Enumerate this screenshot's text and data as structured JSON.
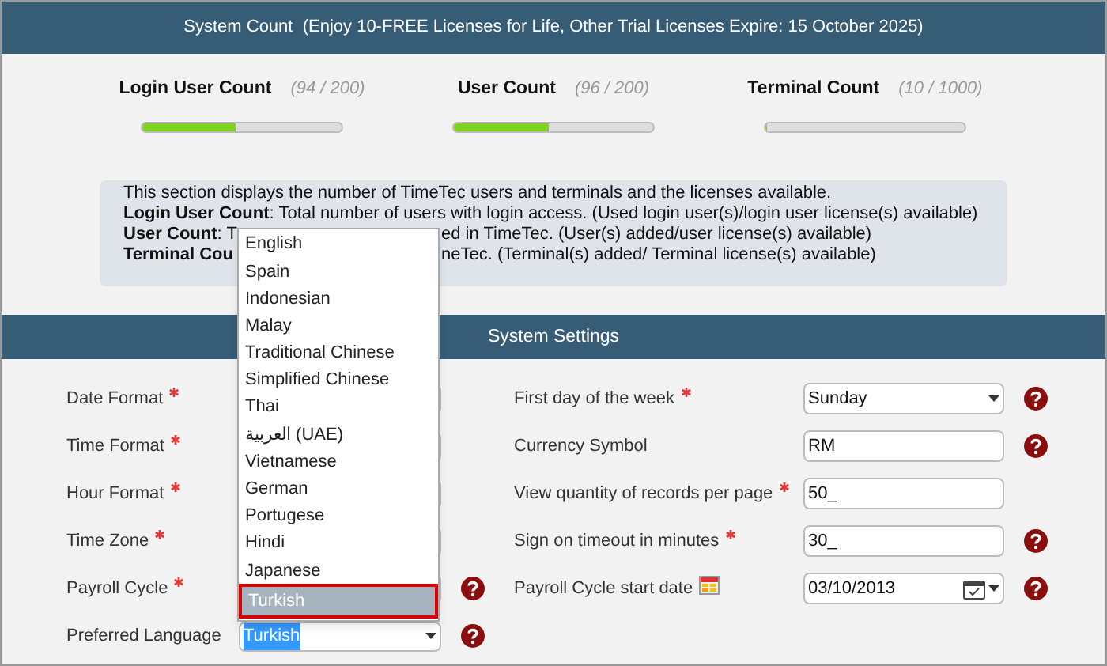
{
  "header": {
    "title": "System Count  (Enjoy 10-FREE Licenses for Life, Other Trial Licenses Expire: 15 October 2025)"
  },
  "counts": [
    {
      "label": "Login User Count",
      "reading": "(94 / 200)",
      "level": 0.47
    },
    {
      "label": "User Count",
      "reading": "(96 / 200)",
      "level": 0.48
    },
    {
      "label": "Terminal Count",
      "reading": "(10 / 1000)",
      "level": 0.01
    }
  ],
  "info": {
    "lines": [
      {
        "left": "This section displays the number of TimeTec users and terminals and the licenses available."
      },
      {
        "left": "**Login User Count**: Total number of users with login access. (Used login user(s)/login user license(s) available)"
      },
      {
        "left": "**User Count**: T",
        "right": "ed in TimeTec. (User(s) added/user license(s) available)"
      },
      {
        "left": "**Terminal Cou**",
        "right": "neTec. (Terminal(s) added/ Terminal license(s) available)"
      }
    ]
  },
  "settings": {
    "title": "System Settings",
    "left": [
      {
        "label": "Date Format",
        "required": true,
        "help": false
      },
      {
        "label": "Time Format",
        "required": true,
        "help": false
      },
      {
        "label": "Hour Format",
        "required": true,
        "help": false
      },
      {
        "label": "Time Zone",
        "required": true,
        "help": false
      },
      {
        "label": "Payroll Cycle",
        "required": true,
        "help": true
      },
      {
        "label": "Preferred Language",
        "required": false,
        "help": true,
        "value": "Turkish",
        "text_selected": true
      }
    ],
    "right": [
      {
        "label": "First day of the week",
        "required": true,
        "kind": "select",
        "value": "Sunday",
        "help": true,
        "calendar_icon": false
      },
      {
        "label": "Currency Symbol",
        "required": false,
        "kind": "text",
        "value": "RM",
        "help": true,
        "calendar_icon": false
      },
      {
        "label": "View quantity of records per page",
        "required": true,
        "kind": "text",
        "value": "50_",
        "help": false,
        "calendar_icon": false
      },
      {
        "label": "Sign on timeout in minutes",
        "required": true,
        "kind": "text",
        "value": "30_",
        "help": true,
        "calendar_icon": false
      },
      {
        "label": "Payroll Cycle start date",
        "required": false,
        "kind": "date",
        "value": "03/10/2013",
        "help": true,
        "calendar_icon": true
      }
    ]
  },
  "language_menu": {
    "options": [
      {
        "label": "English",
        "selected": false
      },
      {
        "label": "Spain",
        "selected": false
      },
      {
        "label": "Indonesian",
        "selected": false
      },
      {
        "label": "Malay",
        "selected": false
      },
      {
        "label": "Traditional Chinese",
        "selected": false
      },
      {
        "label": "Simplified Chinese",
        "selected": false
      },
      {
        "label": "Thai",
        "selected": false
      },
      {
        "label": "العربية (UAE)",
        "selected": false
      },
      {
        "label": "Vietnamese",
        "selected": false
      },
      {
        "label": "German",
        "selected": false
      },
      {
        "label": "Portugese",
        "selected": false
      },
      {
        "label": "Hindi",
        "selected": false
      },
      {
        "label": "Japanese",
        "selected": false
      },
      {
        "label": "Turkish",
        "selected": true
      }
    ]
  }
}
